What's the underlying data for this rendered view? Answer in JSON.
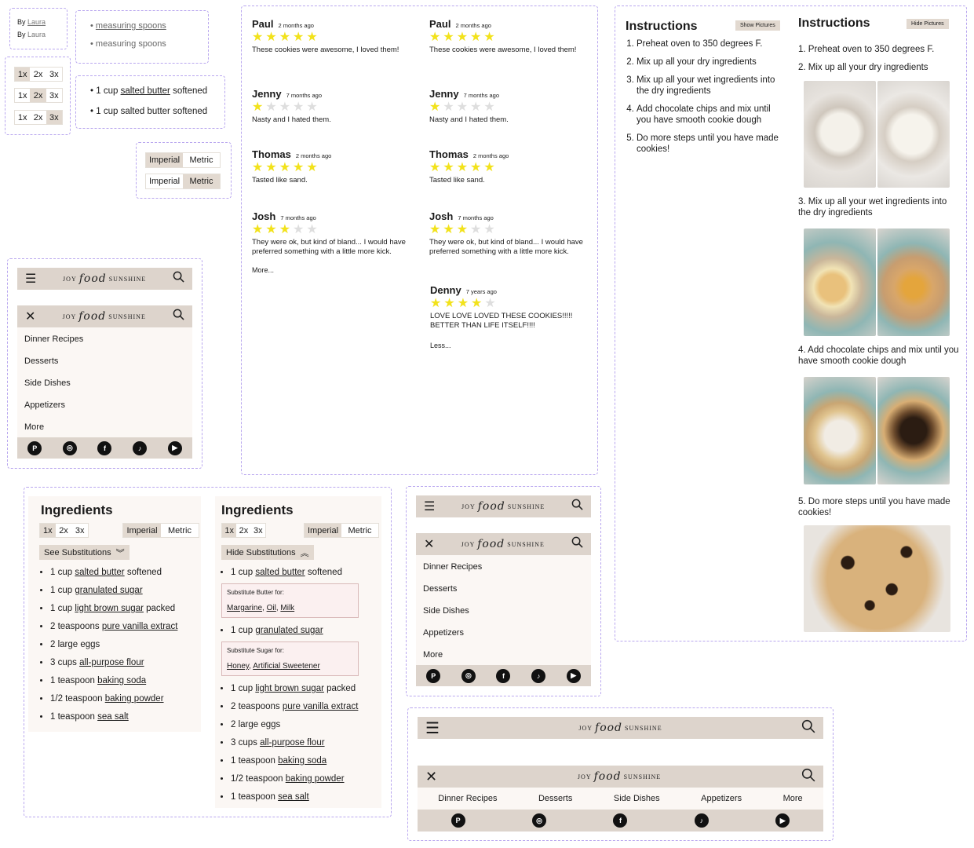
{
  "byline": {
    "prefix": "By",
    "author": "Laura"
  },
  "equipment": [
    "measuring spoons",
    "measuring spoons"
  ],
  "scale_options": [
    "1x",
    "2x",
    "3x"
  ],
  "butter_list": {
    "link": "salted butter",
    "pre": "1 cup",
    "post": "softened"
  },
  "units": {
    "imperial": "Imperial",
    "metric": "Metric"
  },
  "reviews": [
    {
      "name": "Paul",
      "ago": "2 months ago",
      "stars": 5,
      "text": "These cookies were awesome, I loved them!"
    },
    {
      "name": "Jenny",
      "ago": "7 months ago",
      "stars": 1,
      "text": "Nasty and I hated them."
    },
    {
      "name": "Thomas",
      "ago": "2 months ago",
      "stars": 5,
      "text": "Tasted like sand."
    },
    {
      "name": "Josh",
      "ago": "7 months ago",
      "stars": 3,
      "text": "They were ok, but kind of bland... I would have preferred something with a little more kick."
    }
  ],
  "review_extra": {
    "name": "Denny",
    "ago": "7 years ago",
    "stars": 4,
    "text": "LOVE LOVE LOVED THESE COOKIES!!!!! BETTER THAN LIFE ITSELF!!!!"
  },
  "more_label": "More...",
  "less_label": "Less...",
  "nav": {
    "logo": {
      "pre": "JOY",
      "mid": "food",
      "post": "SUNSHINE"
    },
    "items": [
      "Dinner Recipes",
      "Desserts",
      "Side Dishes",
      "Appetizers",
      "More"
    ],
    "social": [
      "pinterest",
      "instagram",
      "facebook",
      "tiktok",
      "youtube"
    ]
  },
  "ingredients": {
    "title": "Ingredients",
    "see_subs": "See Substitutions",
    "hide_subs": "Hide Substitutions",
    "items": [
      {
        "pre": "1 cup",
        "link": "salted butter",
        "post": "softened"
      },
      {
        "pre": "1 cup",
        "link": "granulated sugar",
        "post": ""
      },
      {
        "pre": "1 cup",
        "link": "light brown sugar",
        "post": "packed"
      },
      {
        "pre": "2 teaspoons",
        "link": "pure vanilla extract",
        "post": ""
      },
      {
        "pre": "2 large eggs",
        "link": "",
        "post": ""
      },
      {
        "pre": "3 cups",
        "link": "all-purpose flour",
        "post": ""
      },
      {
        "pre": "1 teaspoon",
        "link": "baking soda",
        "post": ""
      },
      {
        "pre": "1/2 teaspoon",
        "link": "baking powder",
        "post": ""
      },
      {
        "pre": "1 teaspoon",
        "link": "sea salt",
        "post": ""
      }
    ],
    "sub_butter": {
      "label": "Substitute Butter for:",
      "opts": [
        "Margarine",
        "Oil",
        "Milk"
      ]
    },
    "sub_sugar": {
      "label": "Substitute Sugar for:",
      "opts": [
        "Honey",
        "Artificial Sweetener"
      ]
    }
  },
  "instructions": {
    "title": "Instructions",
    "show_pictures": "Show Pictures",
    "hide_pictures": "Hide Pictures",
    "steps": [
      "Preheat oven to 350 degrees F.",
      "Mix up all your dry ingredients",
      "Mix up all your wet ingredients into the dry ingredients",
      "Add chocolate chips and mix until you have smooth cookie dough",
      "Do more steps until you have made cookies!"
    ],
    "step5_alt": "Do  more steps until you have made cookies!"
  },
  "colors": {
    "accent": "#ddd4cc",
    "toggle_on": "#e2d9d0",
    "panel": "#fbf7f4",
    "star": "#f2e21b",
    "frame": "#b9a7ef"
  }
}
